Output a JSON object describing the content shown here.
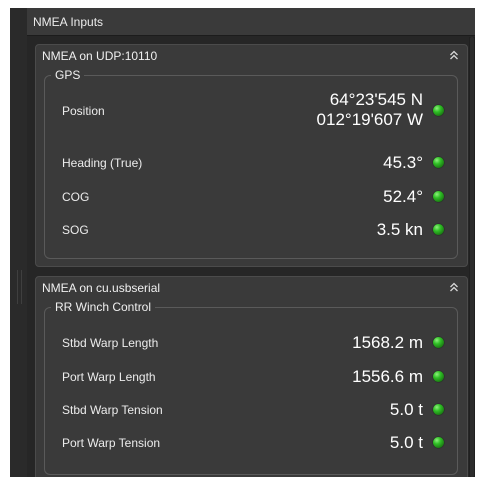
{
  "panel": {
    "title": "NMEA Inputs"
  },
  "sources": [
    {
      "title": "NMEA on UDP:10110",
      "group": "GPS",
      "rows": [
        {
          "label": "Position",
          "value_line1": "64°23'545 N",
          "value_line2": "012°19'607 W",
          "status": "ok"
        },
        {
          "label": "Heading (True)",
          "value": "45.3°",
          "status": "ok"
        },
        {
          "label": "COG",
          "value": "52.4°",
          "status": "ok"
        },
        {
          "label": "SOG",
          "value": "3.5 kn",
          "status": "ok"
        }
      ]
    },
    {
      "title": "NMEA on cu.usbserial",
      "group": "RR Winch Control",
      "rows": [
        {
          "label": "Stbd Warp Length",
          "value": "1568.2 m",
          "status": "ok"
        },
        {
          "label": "Port Warp Length",
          "value": "1556.6 m",
          "status": "ok"
        },
        {
          "label": "Stbd Warp Tension",
          "value": "5.0 t",
          "status": "ok"
        },
        {
          "label": "Port Warp Tension",
          "value": "5.0 t",
          "status": "ok"
        }
      ]
    }
  ],
  "icons": {
    "collapse": "chevron-double-up-icon",
    "status_ok": "green-status-led-icon"
  },
  "colors": {
    "panel_bg": "#262626",
    "section_bg": "#3a3a3a",
    "status_ok": "#2fbf25",
    "text": "#ffffff"
  }
}
